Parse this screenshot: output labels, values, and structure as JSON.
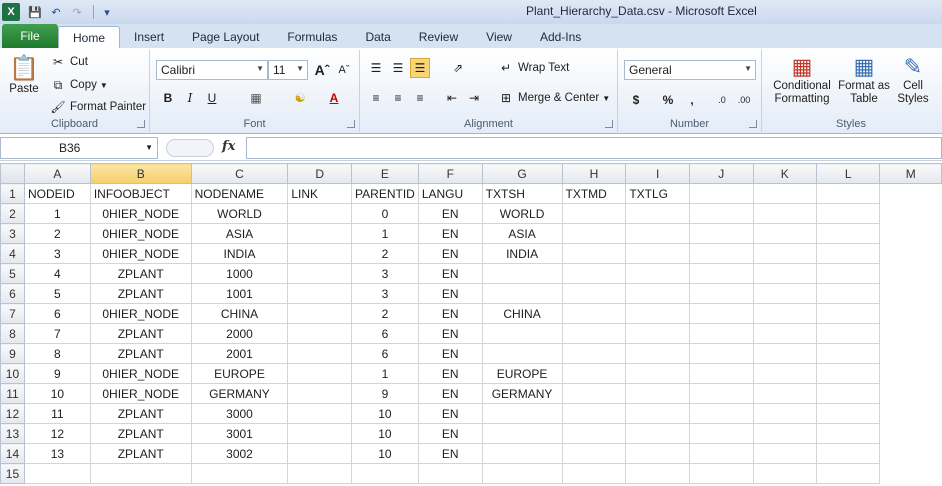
{
  "window": {
    "title": "Plant_Hierarchy_Data.csv  -  Microsoft Excel",
    "app_logo": "X"
  },
  "tabs": [
    "File",
    "Home",
    "Insert",
    "Page Layout",
    "Formulas",
    "Data",
    "Review",
    "View",
    "Add-Ins"
  ],
  "ribbon": {
    "clipboard": {
      "label": "Clipboard",
      "paste": "Paste",
      "cut": "Cut",
      "copy": "Copy",
      "format_painter": "Format Painter"
    },
    "font": {
      "label": "Font",
      "family": "Calibri",
      "size": "11"
    },
    "alignment": {
      "label": "Alignment",
      "wrap_text": "Wrap Text",
      "merge_center": "Merge & Center"
    },
    "number": {
      "label": "Number",
      "format": "General"
    },
    "styles": {
      "label": "Styles",
      "conditional": "Conditional Formatting",
      "format_table": "Format as Table",
      "cell_styles": "Cell Styles"
    }
  },
  "formula_bar": {
    "name_box": "B36",
    "fx": "fx",
    "content": ""
  },
  "sheet": {
    "columns": [
      "A",
      "B",
      "C",
      "D",
      "E",
      "F",
      "G",
      "H",
      "I",
      "J",
      "K",
      "L",
      "M"
    ],
    "rows": [
      [
        "1",
        "NODEID",
        "INFOOBJECT",
        "NODENAME",
        "LINK",
        "PARENTID",
        "LANGU",
        "TXTSH",
        "TXTMD",
        "TXTLG",
        "",
        "",
        ""
      ],
      [
        "2",
        "1",
        "0HIER_NODE",
        "WORLD",
        "",
        "0",
        "EN",
        "WORLD",
        "",
        "",
        "",
        "",
        ""
      ],
      [
        "3",
        "2",
        "0HIER_NODE",
        "ASIA",
        "",
        "1",
        "EN",
        "ASIA",
        "",
        "",
        "",
        "",
        ""
      ],
      [
        "4",
        "3",
        "0HIER_NODE",
        "INDIA",
        "",
        "2",
        "EN",
        "INDIA",
        "",
        "",
        "",
        "",
        ""
      ],
      [
        "5",
        "4",
        "ZPLANT",
        "1000",
        "",
        "3",
        "EN",
        "",
        "",
        "",
        "",
        "",
        ""
      ],
      [
        "6",
        "5",
        "ZPLANT",
        "1001",
        "",
        "3",
        "EN",
        "",
        "",
        "",
        "",
        "",
        ""
      ],
      [
        "7",
        "6",
        "0HIER_NODE",
        "CHINA",
        "",
        "2",
        "EN",
        "CHINA",
        "",
        "",
        "",
        "",
        ""
      ],
      [
        "8",
        "7",
        "ZPLANT",
        "2000",
        "",
        "6",
        "EN",
        "",
        "",
        "",
        "",
        "",
        ""
      ],
      [
        "9",
        "8",
        "ZPLANT",
        "2001",
        "",
        "6",
        "EN",
        "",
        "",
        "",
        "",
        "",
        ""
      ],
      [
        "10",
        "9",
        "0HIER_NODE",
        "EUROPE",
        "",
        "1",
        "EN",
        "EUROPE",
        "",
        "",
        "",
        "",
        ""
      ],
      [
        "11",
        "10",
        "0HIER_NODE",
        "GERMANY",
        "",
        "9",
        "EN",
        "GERMANY",
        "",
        "",
        "",
        "",
        ""
      ],
      [
        "12",
        "11",
        "ZPLANT",
        "3000",
        "",
        "10",
        "EN",
        "",
        "",
        "",
        "",
        "",
        ""
      ],
      [
        "13",
        "12",
        "ZPLANT",
        "3001",
        "",
        "10",
        "EN",
        "",
        "",
        "",
        "",
        "",
        ""
      ],
      [
        "14",
        "13",
        "ZPLANT",
        "3002",
        "",
        "10",
        "EN",
        "",
        "",
        "",
        "",
        "",
        ""
      ],
      [
        "15",
        "",
        "",
        "",
        "",
        "",
        "",
        "",
        "",
        "",
        "",
        "",
        ""
      ]
    ]
  },
  "colors": {
    "file_tab": "#1f7a2e",
    "selected_header": "#f4cf6a"
  }
}
